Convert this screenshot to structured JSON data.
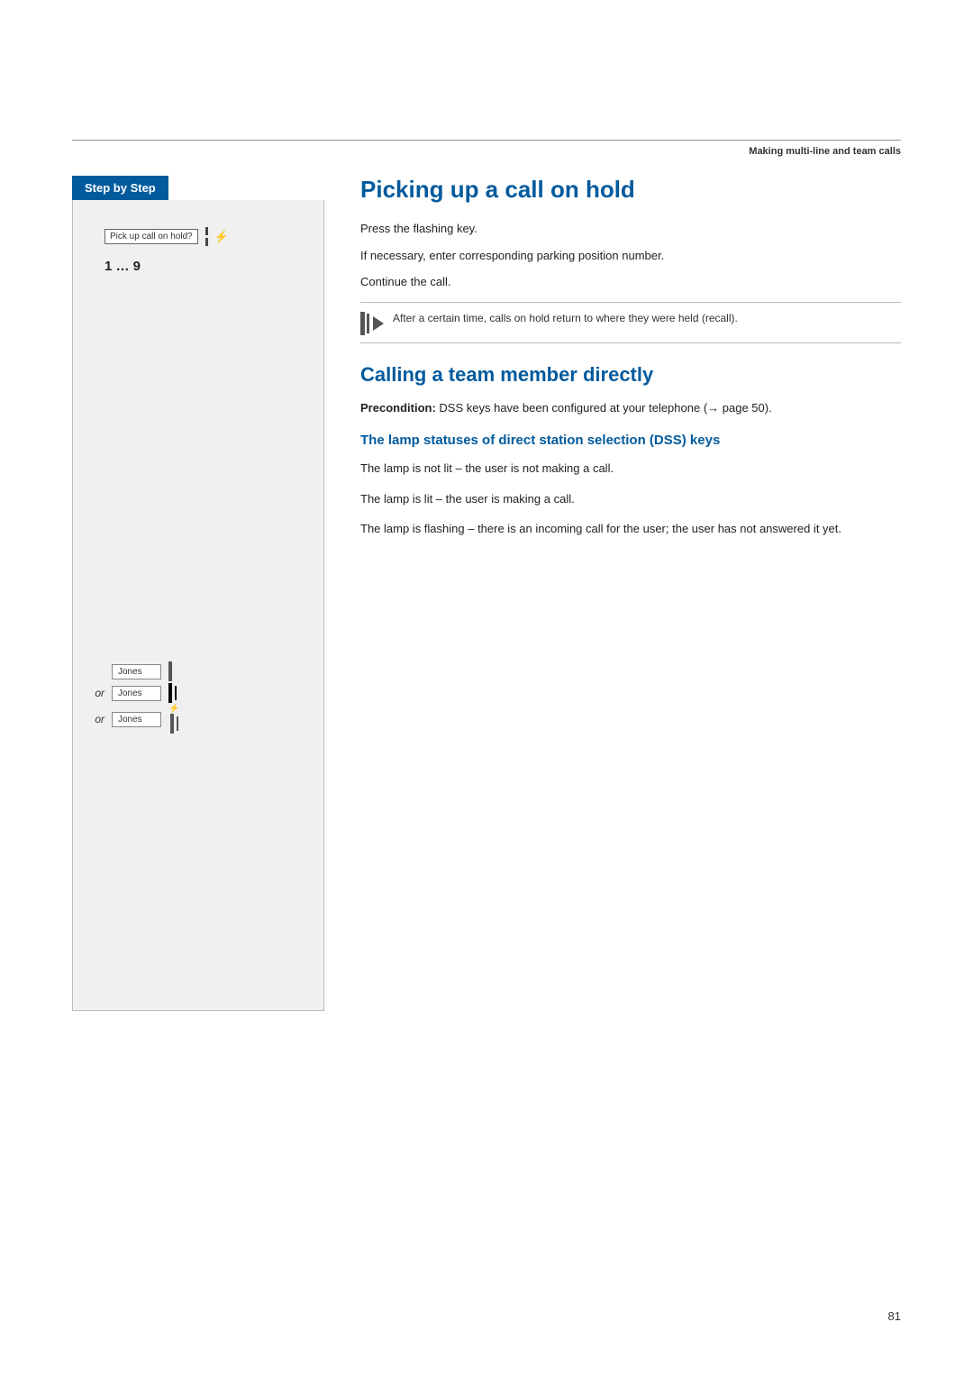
{
  "header": {
    "rule_present": true,
    "label": "Making multi-line and team calls"
  },
  "sidebar": {
    "title": "Step by Step",
    "pickup_label": "Pick up call on hold?",
    "number_range": "1 … 9",
    "dss_rows": [
      {
        "prefix": "",
        "name": "Jones",
        "lamp_type": "off"
      },
      {
        "prefix": "or",
        "name": "Jones",
        "lamp_type": "on"
      },
      {
        "prefix": "or",
        "name": "Jones",
        "lamp_type": "flash"
      }
    ]
  },
  "section1": {
    "title": "Picking up a call on hold",
    "step1": "Press the flashing key.",
    "step2": "If necessary, enter corresponding parking position number.",
    "step3": "Continue the call.",
    "note": "After a certain time, calls on hold return to where they were held (recall)."
  },
  "section2": {
    "title": "Calling a team member directly",
    "precondition_label": "Precondition:",
    "precondition_text": "DSS keys have been configured at your telephone (→ page 50).",
    "subsection_title": "The lamp statuses of direct station selection (DSS) keys",
    "lamp_descriptions": [
      "The lamp is not lit – the user is not making a call.",
      "The lamp is lit – the user is making a call.",
      "The lamp is flashing – there is an incoming call for the user; the user has not answered it yet."
    ]
  },
  "page_number": "81"
}
